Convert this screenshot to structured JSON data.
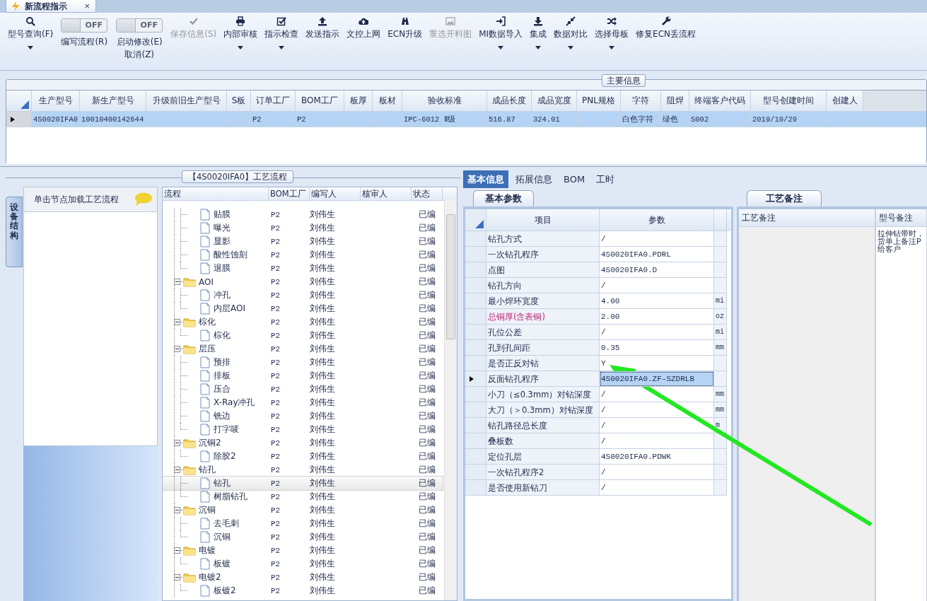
{
  "document_tab": {
    "title": "新流程指示",
    "close": "×"
  },
  "toolbar": [
    {
      "kind": "button",
      "label": "型号查询(F)",
      "dropdown": true,
      "disabled": false
    },
    {
      "kind": "toggle",
      "label": "编写流程(R)",
      "switch_text": "OFF",
      "on": false
    },
    {
      "kind": "toggle",
      "label": "启动修改(E)",
      "label2": "取消(Z)",
      "switch_text": "OFF",
      "on": false
    },
    {
      "kind": "button",
      "label": "保存信息(S)",
      "dropdown": false,
      "disabled": true
    },
    {
      "kind": "button",
      "label": "内部审核",
      "dropdown": true,
      "disabled": false
    },
    {
      "kind": "button",
      "label": "指示检查",
      "dropdown": true,
      "disabled": false
    },
    {
      "kind": "button",
      "label": "发送指示",
      "dropdown": false,
      "disabled": false
    },
    {
      "kind": "button",
      "label": "文控上网",
      "dropdown": false,
      "disabled": false
    },
    {
      "kind": "button",
      "label": "ECN升级",
      "dropdown": false,
      "disabled": false
    },
    {
      "kind": "button",
      "label": "重选开料图",
      "dropdown": false,
      "disabled": true
    },
    {
      "kind": "button",
      "label": "MI数据导入",
      "dropdown": true,
      "disabled": false
    },
    {
      "kind": "button",
      "label": "集成",
      "dropdown": true,
      "disabled": false
    },
    {
      "kind": "button",
      "label": "数据对比",
      "dropdown": true,
      "disabled": false
    },
    {
      "kind": "button",
      "label": "选择母板",
      "dropdown": true,
      "disabled": false
    },
    {
      "kind": "button",
      "label": "修复ECN丢流程",
      "dropdown": false,
      "disabled": false
    }
  ],
  "main_info": {
    "title": "主要信息",
    "columns": [
      "生产型号",
      "新生产型号",
      "升级前旧生产型号",
      "S板",
      "订单工厂",
      "BOM工厂",
      "板厚",
      "板材",
      "验收标准",
      "成品长度",
      "成品宽度",
      "PNL规格",
      "字符",
      "阻焊",
      "终端客户代码",
      "型号创建时间",
      "创建人"
    ],
    "rows": [
      {
        "selected": true,
        "cells": [
          "4S0020IFA0",
          "10010400142644",
          null,
          null,
          "P2",
          "P2",
          null,
          null,
          "IPC-6012 Ⅱ级",
          "516.87",
          "324.01",
          null,
          "白色字符",
          "绿色",
          "S002",
          "2019/10/29",
          null
        ]
      }
    ]
  },
  "side_panel": {
    "tab": "设备结构",
    "header": "单击节点加载工艺流程"
  },
  "process_flow": {
    "title": "【4S0020IFA0】工艺流程",
    "columns": [
      "流程",
      "BOM工厂",
      "编写人",
      "核审人",
      "状态"
    ],
    "nodes": [
      {
        "kind": "offscreen",
        "children": [
          {
            "kind": "step",
            "label": "贴膜",
            "bom": "P2",
            "writer": "刘伟生",
            "status": "已编",
            "selected": false
          },
          {
            "kind": "step",
            "label": "曝光",
            "bom": "P2",
            "writer": "刘伟生",
            "status": "已编",
            "selected": false
          },
          {
            "kind": "step",
            "label": "显影",
            "bom": "P2",
            "writer": "刘伟生",
            "status": "已编",
            "selected": false
          },
          {
            "kind": "step",
            "label": "酸性蚀刻",
            "bom": "P2",
            "writer": "刘伟生",
            "status": "已编",
            "selected": false
          },
          {
            "kind": "step",
            "label": "退膜",
            "bom": "P2",
            "writer": "刘伟生",
            "status": "已编",
            "selected": false
          }
        ]
      },
      {
        "kind": "folder",
        "label": "AOI",
        "bom": "P2",
        "writer": "刘伟生",
        "status": "已编",
        "selected": false,
        "expanded": true,
        "children": [
          {
            "kind": "step",
            "label": "冲孔",
            "bom": "P2",
            "writer": "刘伟生",
            "status": "已编",
            "selected": false
          },
          {
            "kind": "step",
            "label": "内层AOI",
            "bom": "P2",
            "writer": "刘伟生",
            "status": "已编",
            "selected": false
          }
        ]
      },
      {
        "kind": "folder",
        "label": "棕化",
        "bom": "P2",
        "writer": "刘伟生",
        "status": "已编",
        "selected": false,
        "expanded": true,
        "children": [
          {
            "kind": "step",
            "label": "棕化",
            "bom": "P2",
            "writer": "刘伟生",
            "status": "已编",
            "selected": false
          }
        ]
      },
      {
        "kind": "folder",
        "label": "层压",
        "bom": "P2",
        "writer": "刘伟生",
        "status": "已编",
        "selected": false,
        "expanded": true,
        "children": [
          {
            "kind": "step",
            "label": "预排",
            "bom": "P2",
            "writer": "刘伟生",
            "status": "已编",
            "selected": false
          },
          {
            "kind": "step",
            "label": "排板",
            "bom": "P2",
            "writer": "刘伟生",
            "status": "已编",
            "selected": false
          },
          {
            "kind": "step",
            "label": "压合",
            "bom": "P2",
            "writer": "刘伟生",
            "status": "已编",
            "selected": false
          },
          {
            "kind": "step",
            "label": "X-Ray冲孔",
            "bom": "P2",
            "writer": "刘伟生",
            "status": "已编",
            "selected": false
          },
          {
            "kind": "step",
            "label": "铣边",
            "bom": "P2",
            "writer": "刘伟生",
            "status": "已编",
            "selected": false
          },
          {
            "kind": "step",
            "label": "打字唛",
            "bom": "P2",
            "writer": "刘伟生",
            "status": "已编",
            "selected": false
          }
        ]
      },
      {
        "kind": "folder",
        "label": "沉铜2",
        "bom": "P2",
        "writer": "刘伟生",
        "status": "已编",
        "selected": false,
        "expanded": true,
        "children": [
          {
            "kind": "step",
            "label": "除胶2",
            "bom": "P2",
            "writer": "刘伟生",
            "status": "已编",
            "selected": false
          }
        ]
      },
      {
        "kind": "folder",
        "label": "钻孔",
        "bom": "P2",
        "writer": "刘伟生",
        "status": "已编",
        "selected": false,
        "expanded": true,
        "children": [
          {
            "kind": "step",
            "label": "钻孔",
            "bom": "P2",
            "writer": "刘伟生",
            "status": "已编",
            "selected": true
          },
          {
            "kind": "step",
            "label": "树脂钻孔",
            "bom": "P2",
            "writer": "刘伟生",
            "status": "已编",
            "selected": false
          }
        ]
      },
      {
        "kind": "folder",
        "label": "沉铜",
        "bom": "P2",
        "writer": "刘伟生",
        "status": "已编",
        "selected": false,
        "expanded": true,
        "children": [
          {
            "kind": "step",
            "label": "去毛刺",
            "bom": "P2",
            "writer": "刘伟生",
            "status": "已编",
            "selected": false
          },
          {
            "kind": "step",
            "label": "沉铜",
            "bom": "P2",
            "writer": "刘伟生",
            "status": "已编",
            "selected": false
          }
        ]
      },
      {
        "kind": "folder",
        "label": "电镀",
        "bom": "P2",
        "writer": "刘伟生",
        "status": "已编",
        "selected": false,
        "expanded": true,
        "children": [
          {
            "kind": "step",
            "label": "板镀",
            "bom": "P2",
            "writer": "刘伟生",
            "status": "已编",
            "selected": false
          }
        ]
      },
      {
        "kind": "folder",
        "label": "电镀2",
        "bom": "P2",
        "writer": "刘伟生",
        "status": "已编",
        "selected": false,
        "expanded": true,
        "children": [
          {
            "kind": "step",
            "label": "板镀2",
            "bom": "P2",
            "writer": "刘伟生",
            "status": "已编",
            "selected": false
          }
        ]
      }
    ]
  },
  "detail_tabs": [
    {
      "label": "基本信息",
      "selected": true
    },
    {
      "label": "拓展信息",
      "selected": false
    },
    {
      "label": "BOM",
      "selected": false
    },
    {
      "label": "工时",
      "selected": false
    }
  ],
  "basic_params": {
    "tab": "基本参数",
    "columns": [
      "项目",
      "参数"
    ],
    "rows": [
      {
        "item": "钻孔方式",
        "value": "/",
        "flagged": false,
        "selected": false
      },
      {
        "item": "一次钻孔程序",
        "value": "4S0020IFA0.PDRL",
        "flagged": false,
        "selected": false
      },
      {
        "item": "点图",
        "value": "4S0020IFA0.D",
        "flagged": false,
        "selected": false
      },
      {
        "item": "钻孔方向",
        "value": "/",
        "flagged": false,
        "selected": false
      },
      {
        "item": "最小焊环宽度",
        "value": "4.00",
        "unit": "mi",
        "flagged": false,
        "selected": false
      },
      {
        "item": "总铜厚(含表铜)",
        "value": "2.00",
        "unit": "oz",
        "flagged": true,
        "selected": false
      },
      {
        "item": "孔位公差",
        "value": "/",
        "unit": "mi",
        "flagged": false,
        "selected": false
      },
      {
        "item": "孔到孔间距",
        "value": "0.35",
        "unit": "mm",
        "flagged": false,
        "selected": false
      },
      {
        "item": "是否正反对钻",
        "value": "Y",
        "flagged": false,
        "selected": false
      },
      {
        "item": "反面钻孔程序",
        "value": "4S0020IFA0.ZF-SZDRLB",
        "flagged": false,
        "selected": true
      },
      {
        "item": "小刀（≤0.3mm）对钻深度",
        "value": "/",
        "unit": "mm",
        "flagged": false,
        "selected": false
      },
      {
        "item": "大刀（＞0.3mm）对钻深度",
        "value": "/",
        "unit": "mm",
        "flagged": false,
        "selected": false
      },
      {
        "item": "钻孔路径总长度",
        "value": "/",
        "unit": "m",
        "flagged": false,
        "selected": false
      },
      {
        "item": "叠板数",
        "value": "/",
        "flagged": false,
        "selected": false
      },
      {
        "item": "定位孔层",
        "value": "4S0020IFA0.PDWK",
        "flagged": false,
        "selected": false
      },
      {
        "item": "一次钻孔程序2",
        "value": "/",
        "flagged": false,
        "selected": false
      },
      {
        "item": "是否使用新钻刀",
        "value": "/",
        "flagged": false,
        "selected": false
      }
    ]
  },
  "remarks": {
    "tab": "工艺备注",
    "columns": [
      "工艺备注",
      "型号备注"
    ],
    "model_remark_lines": [
      "拉伸钻带时，",
      "货单上备注P",
      "给客户"
    ]
  }
}
